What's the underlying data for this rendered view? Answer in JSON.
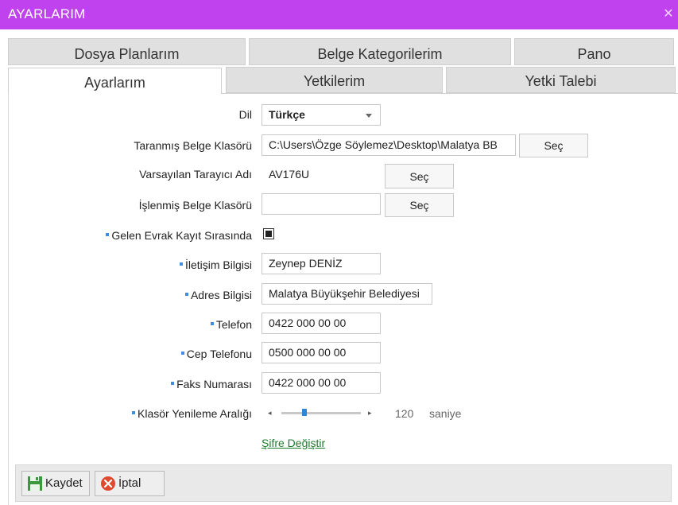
{
  "window": {
    "title": "AYARLARIM"
  },
  "tabs": {
    "row1": [
      "Dosya Planlarım",
      "Belge Kategorilerim",
      "Pano"
    ],
    "row2": [
      "Ayarlarım",
      "Yetkilerim",
      "Yetki Talebi"
    ]
  },
  "form": {
    "language": {
      "label": "Dil",
      "value": "Türkçe"
    },
    "scanned_folder": {
      "label": "Taranmış Belge Klasörü",
      "value": "C:\\Users\\Özge Söylemez\\Desktop\\Malatya BB",
      "button": "Seç"
    },
    "default_scanner": {
      "label": "Varsayılan Tarayıcı Adı",
      "value": "AV176U",
      "button": "Seç"
    },
    "processed_folder": {
      "label": "İşlenmiş Belge Klasörü",
      "value": "",
      "button": "Seç"
    },
    "incoming_record": {
      "label": "Gelen Evrak Kayıt Sırasında",
      "checked": true
    },
    "contact_info": {
      "label": "İletişim Bilgisi",
      "value": "Zeynep DENİZ"
    },
    "address_info": {
      "label": "Adres Bilgisi",
      "value": "Malatya Büyükşehir Belediyesi"
    },
    "phone": {
      "label": "Telefon",
      "value": "0422 000 00 00"
    },
    "mobile_phone": {
      "label": "Cep Telefonu",
      "value": "0500 000 00 00"
    },
    "fax": {
      "label": "Faks Numarası",
      "value": "0422 000 00 00"
    },
    "refresh_interval": {
      "label": "Klasör Yenileme Aralığı",
      "value": "120",
      "unit": "saniye",
      "slider_fraction": 0.29
    },
    "change_password": "Şifre Değiştir"
  },
  "footer": {
    "save": "Kaydet",
    "cancel": "İptal"
  },
  "colors": {
    "titlebar": "#c042ef",
    "accent_bullet": "#3d8ee0",
    "link": "#1d7d2d",
    "save_icon": "#3a9a3a",
    "cancel_icon": "#e04a2f"
  }
}
